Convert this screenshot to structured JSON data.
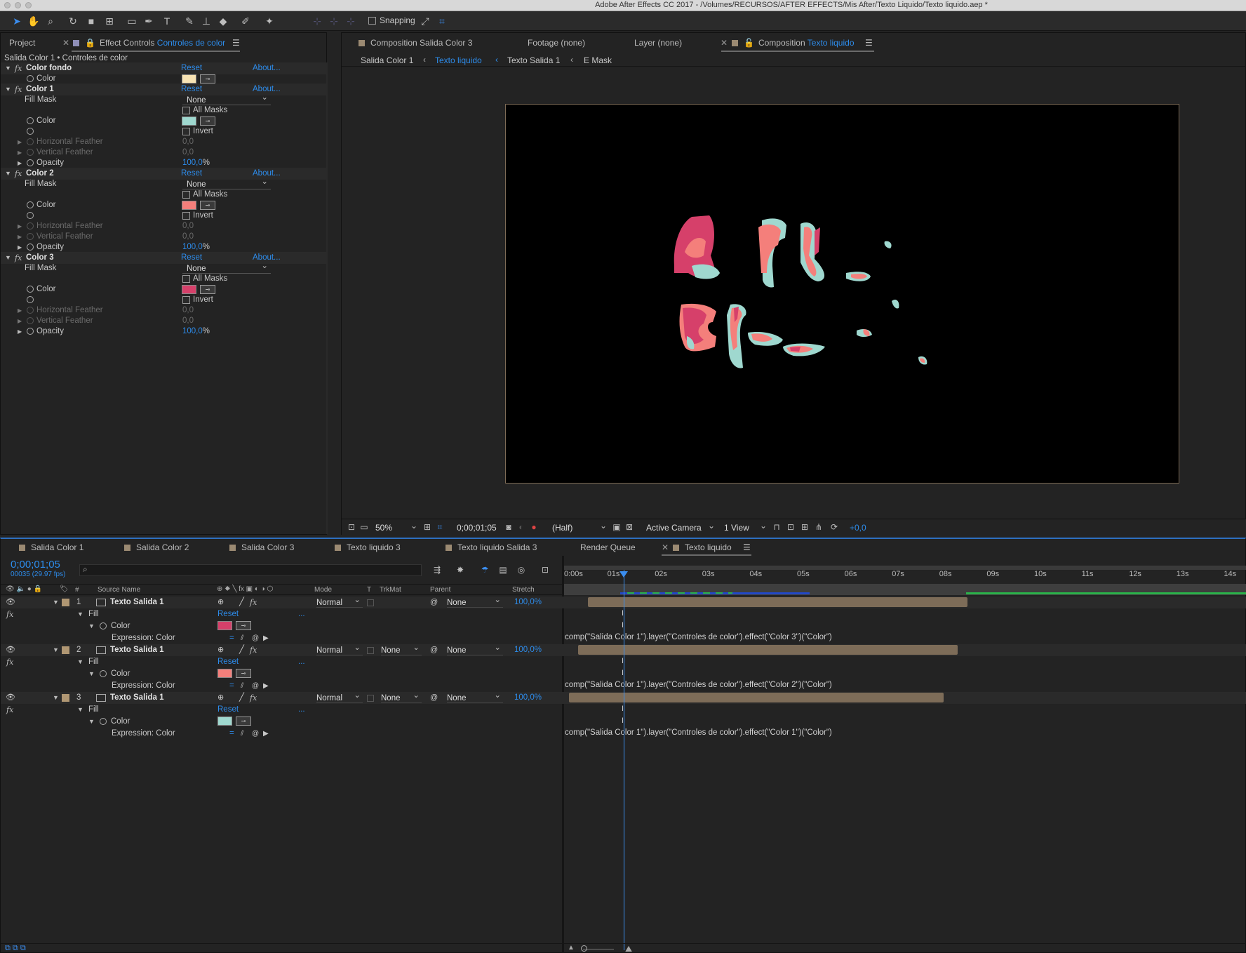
{
  "window": {
    "title": "Adobe After Effects CC 2017 - /Volumes/RECURSOS/AFTER EFFECTS/Mis After/Texto Liquido/Texto liquido.aep *"
  },
  "toolbar": {
    "snapping_label": "Snapping"
  },
  "effect_controls": {
    "tab_project": "Project",
    "tab_label": "Effect Controls",
    "tab_target": "Controles de color",
    "breadcrumb": "Salida Color 1 • Controles de color",
    "reset": "Reset",
    "about": "About...",
    "effects": [
      {
        "name": "Color fondo",
        "color": "#f7e3b4"
      },
      {
        "name": "Color 1",
        "fill_mask_label": "Fill Mask",
        "fill_mask": "None",
        "all_masks": "All Masks",
        "color_label": "Color",
        "color": "#9fd8cf",
        "invert": "Invert",
        "h_feather_label": "Horizontal Feather",
        "h_feather": "0,0",
        "v_feather_label": "Vertical Feather",
        "v_feather": "0,0",
        "opacity_label": "Opacity",
        "opacity": "100,0",
        "opacity_unit": "%"
      },
      {
        "name": "Color 2",
        "fill_mask_label": "Fill Mask",
        "fill_mask": "None",
        "all_masks": "All Masks",
        "color_label": "Color",
        "color": "#f47f7b",
        "invert": "Invert",
        "h_feather_label": "Horizontal Feather",
        "h_feather": "0,0",
        "v_feather_label": "Vertical Feather",
        "v_feather": "0,0",
        "opacity_label": "Opacity",
        "opacity": "100,0",
        "opacity_unit": "%"
      },
      {
        "name": "Color 3",
        "fill_mask_label": "Fill Mask",
        "fill_mask": "None",
        "all_masks": "All Masks",
        "color_label": "Color",
        "color": "#d6406a",
        "invert": "Invert",
        "h_feather_label": "Horizontal Feather",
        "h_feather": "0,0",
        "v_feather_label": "Vertical Feather",
        "v_feather": "0,0",
        "opacity_label": "Opacity",
        "opacity": "100,0",
        "opacity_unit": "%"
      }
    ],
    "color_fondo_color_label": "Color"
  },
  "comp_viewer": {
    "tabs": [
      {
        "prefix": "Composition",
        "name": "Salida Color 3"
      },
      {
        "prefix": "Footage",
        "name": "(none)"
      },
      {
        "prefix": "Layer",
        "name": "(none)"
      },
      {
        "prefix": "Composition",
        "name": "Texto liquido"
      }
    ],
    "breadcrumbs": [
      "Salida Color 1",
      "Texto liquido",
      "Texto Salida 1",
      "E Mask"
    ],
    "zoom": "50%",
    "timecode": "0;00;01;05",
    "resolution": "(Half)",
    "camera": "Active Camera",
    "views": "1 View",
    "exposure": "+0,0"
  },
  "timeline": {
    "tabs": [
      "Salida Color 1",
      "Salida Color 2",
      "Salida Color 3",
      "Texto liquido 3",
      "Texto liquido Salida 3",
      "Render Queue",
      "Texto liquido"
    ],
    "current_time": "0;00;01;05",
    "frame_info": "00035 (29.97 fps)",
    "columns": {
      "num": "#",
      "source": "Source Name",
      "mode": "Mode",
      "t": "T",
      "trkmat": "TrkMat",
      "parent": "Parent",
      "stretch": "Stretch"
    },
    "ruler": [
      "0:00s",
      "01s",
      "02s",
      "03s",
      "04s",
      "05s",
      "06s",
      "07s",
      "08s",
      "09s",
      "10s",
      "11s",
      "12s",
      "13s",
      "14s"
    ],
    "layers": [
      {
        "num": "1",
        "name": "Texto Salida 1",
        "mode": "Normal",
        "trkmat": "",
        "parent": "None",
        "stretch": "100,0%",
        "fill": "Fill",
        "reset": "Reset",
        "dots": "...",
        "color_label": "Color",
        "color": "#d6406a",
        "expr_label": "Expression: Color",
        "expression": "comp(\"Salida Color 1\").layer(\"Controles de color\").effect(\"Color 3\")(\"Color\")",
        "bar_start_s": 0.5,
        "bar_end_s": 8.5
      },
      {
        "num": "2",
        "name": "Texto Salida 1",
        "mode": "Normal",
        "trkmat": "None",
        "parent": "None",
        "stretch": "100,0%",
        "fill": "Fill",
        "reset": "Reset",
        "dots": "...",
        "color_label": "Color",
        "color": "#f47f7b",
        "expr_label": "Expression: Color",
        "expression": "comp(\"Salida Color 1\").layer(\"Controles de color\").effect(\"Color 2\")(\"Color\")",
        "bar_start_s": 0.3,
        "bar_end_s": 8.3
      },
      {
        "num": "3",
        "name": "Texto Salida 1",
        "mode": "Normal",
        "trkmat": "None",
        "parent": "None",
        "stretch": "100,0%",
        "fill": "Fill",
        "reset": "Reset",
        "dots": "...",
        "color_label": "Color",
        "color": "#9fd8cf",
        "expr_label": "Expression: Color",
        "expression": "comp(\"Salida Color 1\").layer(\"Controles de color\").effect(\"Color 1\")(\"Color\")",
        "bar_start_s": 0.1,
        "bar_end_s": 8.0
      }
    ]
  }
}
